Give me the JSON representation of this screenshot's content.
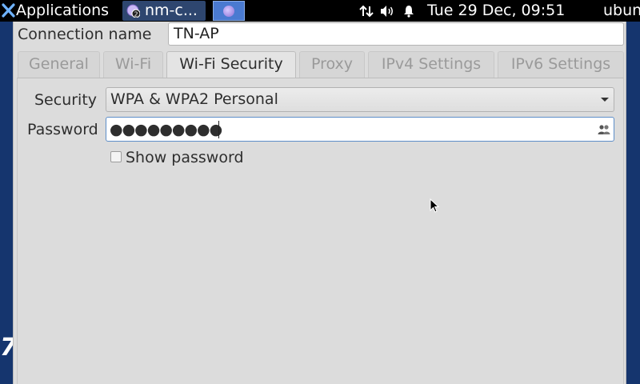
{
  "panel": {
    "applications_label": "Applications",
    "task_label": "nm-c...",
    "task_badge": "2",
    "clock": "Tue 29 Dec, 09:51",
    "user": "ubuntu"
  },
  "desktop": {
    "edge_glyph": "7"
  },
  "dialog": {
    "connection_name_label": "Connection name",
    "connection_name_value": "TN-AP",
    "tabs": [
      {
        "label": "General",
        "active": false
      },
      {
        "label": "Wi-Fi",
        "active": false
      },
      {
        "label": "Wi-Fi Security",
        "active": true
      },
      {
        "label": "Proxy",
        "active": false
      },
      {
        "label": "IPv4 Settings",
        "active": false
      },
      {
        "label": "IPv6 Settings",
        "active": false
      }
    ],
    "security_label": "Security",
    "security_value": "WPA & WPA2 Personal",
    "password_label": "Password",
    "password_mask": "●●●●●●●●●",
    "show_password_label": "Show password",
    "show_password_checked": false
  },
  "colors": {
    "desktop": "#15356e",
    "panel": "#000000",
    "dialog_bg": "#dcdcdc",
    "focus_border": "#5d8ec9"
  }
}
